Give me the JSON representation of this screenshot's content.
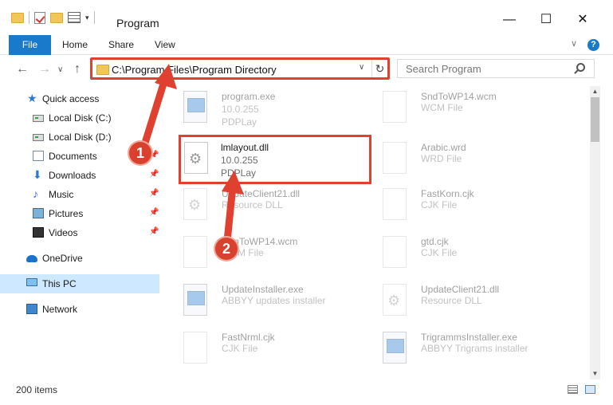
{
  "window": {
    "title": "Program",
    "minimize_glyph": "—",
    "maximize_glyph": "☐",
    "close_glyph": "✕"
  },
  "ribbon": {
    "file": "File",
    "tabs": [
      "Home",
      "Share",
      "View"
    ],
    "help_glyph": "?"
  },
  "address": {
    "path": "C:\\Program Files\\Program Directory",
    "search_placeholder": "Search Program"
  },
  "sidebar": {
    "items": [
      {
        "label": "Quick access",
        "icon": "star-icon"
      },
      {
        "label": "Local Disk (C:)",
        "icon": "disk-icon"
      },
      {
        "label": "Local Disk (D:)",
        "icon": "disk-icon"
      },
      {
        "label": "Documents",
        "icon": "documents-icon",
        "pinned": true
      },
      {
        "label": "Downloads",
        "icon": "downloads-icon",
        "pinned": true
      },
      {
        "label": "Music",
        "icon": "music-icon",
        "pinned": true
      },
      {
        "label": "Pictures",
        "icon": "pictures-icon",
        "pinned": true
      },
      {
        "label": "Videos",
        "icon": "videos-icon",
        "pinned": true
      },
      {
        "label": "OneDrive",
        "icon": "onedrive-icon"
      },
      {
        "label": "This PC",
        "icon": "pc-icon",
        "selected": true
      },
      {
        "label": "Network",
        "icon": "network-icon"
      }
    ]
  },
  "files": [
    {
      "name": "program.exe",
      "l2": "10.0.255",
      "l3": "PDPLay",
      "icon": "exe"
    },
    {
      "name": "SndToWP14.wcm",
      "l2": "WCM File",
      "icon": "doc"
    },
    {
      "name": "lmlayout.dll",
      "l2": "10.0.255",
      "l3": "PDPLay",
      "icon": "gear"
    },
    {
      "name": "Arabic.wrd",
      "l2": "WRD File",
      "icon": "doc"
    },
    {
      "name": "UpdateClient21.dll",
      "l2": "Resource DLL",
      "icon": "gear"
    },
    {
      "name": "FastKorn.cjk",
      "l2": "CJK File",
      "icon": "doc"
    },
    {
      "name": "TsmToWP14.wcm",
      "l2": "WCM File",
      "icon": "doc"
    },
    {
      "name": "gtd.cjk",
      "l2": "CJK File",
      "icon": "doc"
    },
    {
      "name": "UpdateInstaller.exe",
      "l2": "ABBYY updates installer",
      "icon": "exe"
    },
    {
      "name": "UpdateClient21.dll",
      "l2": "Resource DLL",
      "icon": "gear"
    },
    {
      "name": "FastNrml.cjk",
      "l2": "CJK File",
      "icon": "doc"
    },
    {
      "name": "TrigrammsInstaller.exe",
      "l2": "ABBYY Trigrams installer",
      "icon": "exe"
    }
  ],
  "status": {
    "items_count": "200 items"
  },
  "callouts": [
    "1",
    "2"
  ],
  "colors": {
    "accent": "#1979ca",
    "highlight": "#e0402f",
    "selected": "#cde8ff"
  }
}
